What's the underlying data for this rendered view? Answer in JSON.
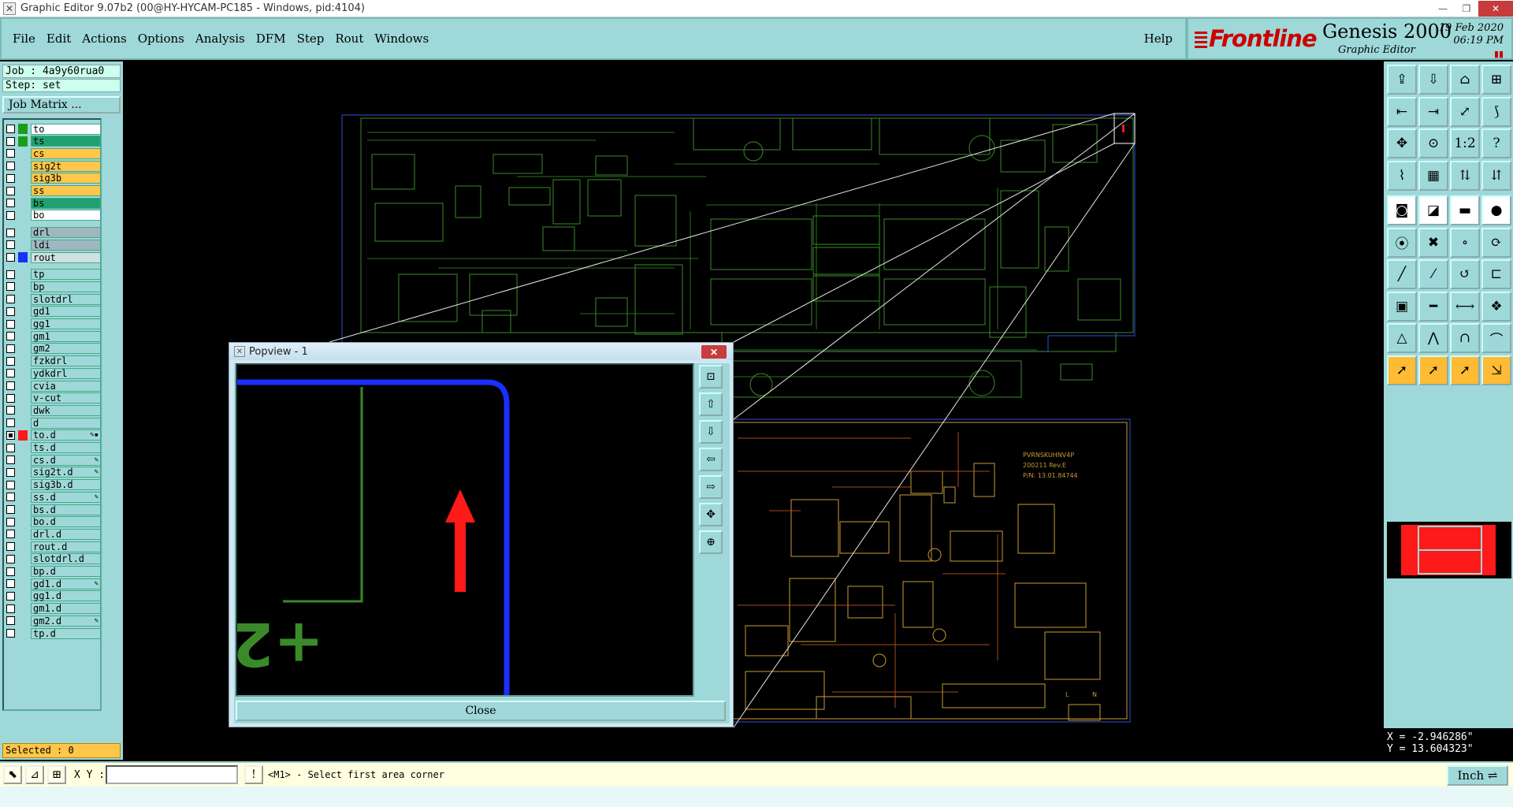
{
  "window": {
    "title": "Graphic Editor 9.07b2 (00@HY-HYCAM-PC185 - Windows, pid:4104)",
    "min": "—",
    "max": "❐",
    "close": "✕"
  },
  "menu": {
    "items": [
      "File",
      "Edit",
      "Actions",
      "Options",
      "Analysis",
      "DFM",
      "Step",
      "Rout",
      "Windows"
    ],
    "help": "Help"
  },
  "brand": {
    "logo": "Frontline",
    "product": "Genesis 2000",
    "subtitle": "Graphic Editor",
    "date": "19 Feb 2020",
    "time": "06:19 PM"
  },
  "job": {
    "job_line": "Job : 4a9y60rua0",
    "step_line": "Step: set",
    "job_matrix": "Job Matrix ..."
  },
  "layers": [
    {
      "name": "to",
      "color": "#1a9e1a",
      "bg": "#ffffff",
      "checked": false
    },
    {
      "name": "ts",
      "color": "#1a9e1a",
      "bg": "#20a070",
      "checked": false
    },
    {
      "name": "cs",
      "color": "",
      "bg": "#ffc64a",
      "checked": false
    },
    {
      "name": "sig2t",
      "color": "",
      "bg": "#ffc64a",
      "checked": false
    },
    {
      "name": "sig3b",
      "color": "",
      "bg": "#ffc64a",
      "checked": false
    },
    {
      "name": "ss",
      "color": "",
      "bg": "#ffc64a",
      "checked": false
    },
    {
      "name": "bs",
      "color": "",
      "bg": "#20a070",
      "checked": false
    },
    {
      "name": "bo",
      "color": "",
      "bg": "#ffffff",
      "checked": false
    },
    {
      "name": "drl",
      "color": "",
      "bg": "#9fb8c0",
      "checked": false
    },
    {
      "name": "ldi",
      "color": "",
      "bg": "#9fb8c0",
      "checked": false
    },
    {
      "name": "rout",
      "color": "#1a2eff",
      "bg": "#d0e0e0",
      "checked": false
    },
    {
      "name": "tp",
      "color": "",
      "bg": "#9fd8d8",
      "checked": false
    },
    {
      "name": "bp",
      "color": "",
      "bg": "#9fd8d8",
      "checked": false
    },
    {
      "name": "slotdrl",
      "color": "",
      "bg": "#9fd8d8",
      "checked": false
    },
    {
      "name": "gd1",
      "color": "",
      "bg": "#9fd8d8",
      "checked": false
    },
    {
      "name": "gg1",
      "color": "",
      "bg": "#9fd8d8",
      "checked": false
    },
    {
      "name": "gm1",
      "color": "",
      "bg": "#9fd8d8",
      "checked": false
    },
    {
      "name": "gm2",
      "color": "",
      "bg": "#9fd8d8",
      "checked": false
    },
    {
      "name": "fzkdrl",
      "color": "",
      "bg": "#9fd8d8",
      "checked": false
    },
    {
      "name": "ydkdrl",
      "color": "",
      "bg": "#9fd8d8",
      "checked": false
    },
    {
      "name": "cvia",
      "color": "",
      "bg": "#9fd8d8",
      "checked": false
    },
    {
      "name": "v-cut",
      "color": "",
      "bg": "#9fd8d8",
      "checked": false
    },
    {
      "name": "dwk",
      "color": "",
      "bg": "#9fd8d8",
      "checked": false
    },
    {
      "name": "d",
      "color": "",
      "bg": "#9fd8d8",
      "checked": false
    },
    {
      "name": "to.d",
      "color": "#ff1a1a",
      "bg": "#9fd8d8",
      "checked": true,
      "edit": "✎▪"
    },
    {
      "name": "ts.d",
      "color": "",
      "bg": "#9fd8d8",
      "checked": false
    },
    {
      "name": "cs.d",
      "color": "",
      "bg": "#9fd8d8",
      "checked": false,
      "edit": "✎"
    },
    {
      "name": "sig2t.d",
      "color": "",
      "bg": "#9fd8d8",
      "checked": false,
      "edit": "✎"
    },
    {
      "name": "sig3b.d",
      "color": "",
      "bg": "#9fd8d8",
      "checked": false
    },
    {
      "name": "ss.d",
      "color": "",
      "bg": "#9fd8d8",
      "checked": false,
      "edit": "✎"
    },
    {
      "name": "bs.d",
      "color": "",
      "bg": "#9fd8d8",
      "checked": false
    },
    {
      "name": "bo.d",
      "color": "",
      "bg": "#9fd8d8",
      "checked": false
    },
    {
      "name": "drl.d",
      "color": "",
      "bg": "#9fd8d8",
      "checked": false
    },
    {
      "name": "rout.d",
      "color": "",
      "bg": "#9fd8d8",
      "checked": false
    },
    {
      "name": "slotdrl.d",
      "color": "",
      "bg": "#9fd8d8",
      "checked": false
    },
    {
      "name": "bp.d",
      "color": "",
      "bg": "#9fd8d8",
      "checked": false
    },
    {
      "name": "gd1.d",
      "color": "",
      "bg": "#9fd8d8",
      "checked": false,
      "edit": "✎"
    },
    {
      "name": "gg1.d",
      "color": "",
      "bg": "#9fd8d8",
      "checked": false
    },
    {
      "name": "gm1.d",
      "color": "",
      "bg": "#9fd8d8",
      "checked": false
    },
    {
      "name": "gm2.d",
      "color": "",
      "bg": "#9fd8d8",
      "checked": false,
      "edit": "✎"
    },
    {
      "name": "tp.d",
      "color": "",
      "bg": "#9fd8d8",
      "checked": false
    }
  ],
  "selected": "Selected : 0",
  "popview": {
    "title": "Popview - 1",
    "close_label": "Close",
    "feature_text": "+2"
  },
  "board_text": {
    "code_line1": "PVRNSKUHNV4P",
    "code_line2": "200211 Rev.E",
    "code_line3": "P/N: 13.01.84744",
    "label_n": "N",
    "label_l": "L"
  },
  "coords": {
    "x": "X = -2.946286\"",
    "y": "Y = 13.604323\""
  },
  "status": {
    "xy_label": "X Y :",
    "xy_value": "",
    "prompt": "<M1> - Select first area corner",
    "unit": "Inch ⇌"
  },
  "colors": {
    "panel": "#9fd8d8",
    "layer_active": "#ffc64a",
    "board_green": "#3a8a2a",
    "board_yellow": "#d8a030",
    "rout_blue": "#1a2eff",
    "arrow_red": "#ff1a1a"
  }
}
